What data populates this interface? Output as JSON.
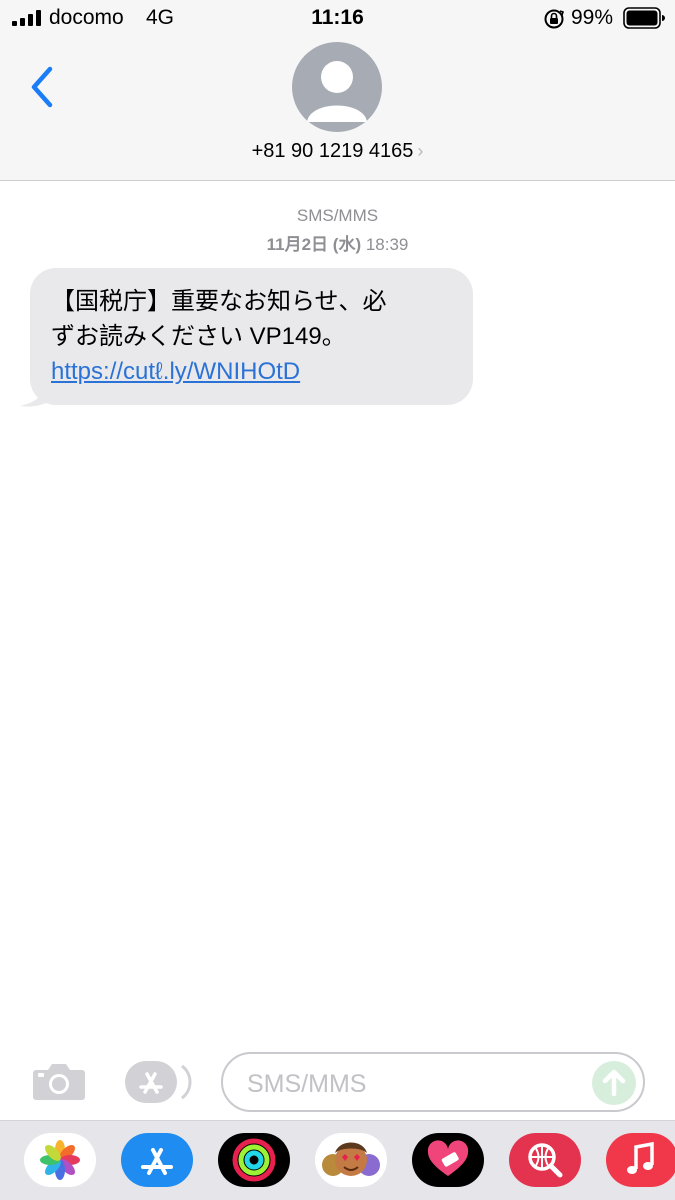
{
  "status_bar": {
    "carrier": "docomo",
    "network": "4G",
    "time": "11:16",
    "battery_percent": "99%"
  },
  "header": {
    "contact_number": "+81 90 1219 4165",
    "chevron": "›"
  },
  "thread": {
    "message_type": "SMS/MMS",
    "date_prefix": "11月2日",
    "date_day": "(水)",
    "date_time": "18:39",
    "messages": [
      {
        "text_line1": "【国税庁】重要なお知らせ、必",
        "text_line2": "ずお読みください VP149。",
        "link": "https://cutℓ.ly/WNIHOtD"
      }
    ]
  },
  "compose": {
    "placeholder": "SMS/MMS"
  },
  "icons": {
    "back": "chevron-left-icon",
    "avatar": "person-icon",
    "camera": "camera-icon",
    "apps": "app-store-icon",
    "send": "arrow-up-icon",
    "apps_strip": [
      "photos-icon",
      "app-store-icon",
      "activity-icon",
      "memoji-icon",
      "heart-app-icon",
      "search-globe-icon",
      "music-icon"
    ]
  },
  "colors": {
    "link": "#2a72d5",
    "bubble": "#e9e9eb",
    "ios_blue": "#1a7cf6"
  }
}
